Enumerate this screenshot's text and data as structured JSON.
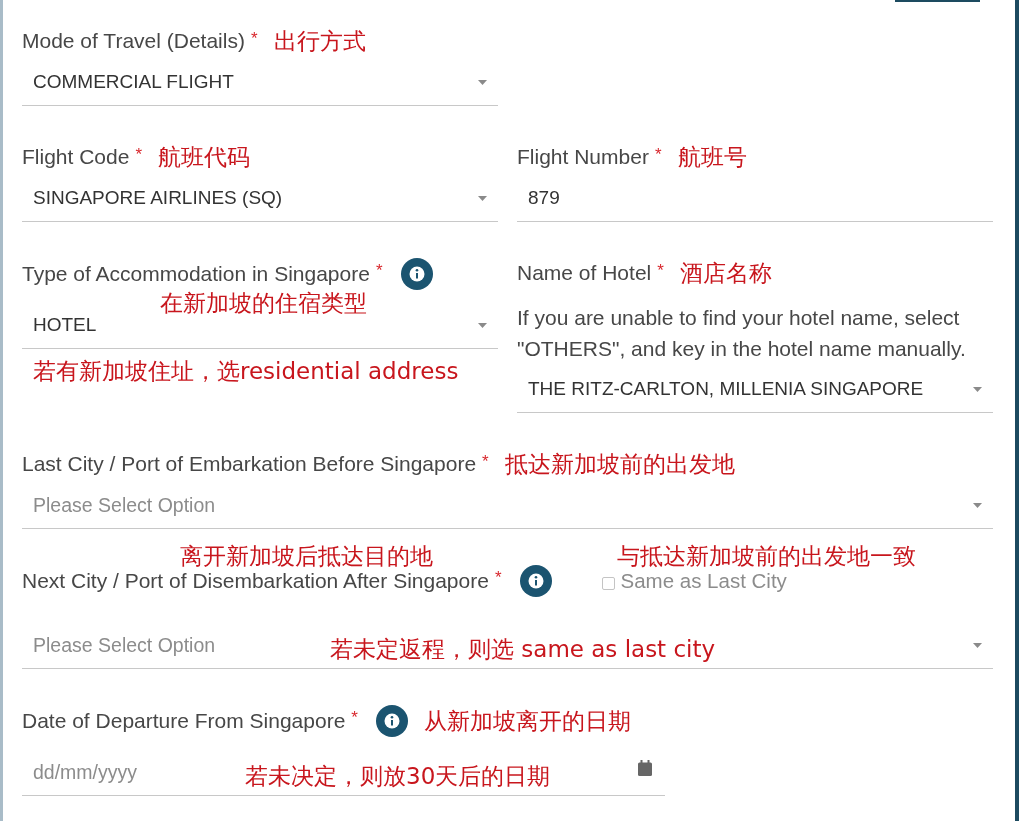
{
  "form": {
    "rows": [
      {
        "kind": "split",
        "fields": [
          {
            "kind": "select",
            "label": "Mode of Travel (Details)",
            "required_mark": "*",
            "info": false,
            "value": "COMMERCIAL FLIGHT",
            "annotations": [
              {
                "text": "出行方式",
                "kind": "beside-label"
              }
            ]
          }
        ]
      },
      {
        "kind": "split",
        "fields": [
          {
            "kind": "select",
            "label": "Flight Code",
            "required_mark": "*",
            "info": false,
            "value": "SINGAPORE AIRLINES (SQ)",
            "annotations": [
              {
                "text": "航班代码",
                "kind": "beside-label"
              }
            ]
          },
          {
            "kind": "text",
            "label": "Flight Number",
            "required_mark": "*",
            "info": false,
            "value": "879",
            "annotations": [
              {
                "text": "航班号",
                "kind": "beside-label"
              }
            ]
          }
        ]
      },
      {
        "kind": "split",
        "fields": [
          {
            "kind": "select",
            "label": "Type of Accommodation in Singapore",
            "required_mark": "*",
            "info": true,
            "value": "HOTEL",
            "annotations": [
              {
                "text": "在新加坡的住宿类型",
                "kind": "under-label"
              },
              {
                "text": "若有新加坡住址，选residential address",
                "kind": "under-field"
              }
            ]
          },
          {
            "kind": "select",
            "label": "Name of Hotel",
            "required_mark": "*",
            "info": false,
            "help": "If you are unable to find your hotel name, select \"OTHERS\", and key in the hotel name manually.",
            "value": "THE RITZ-CARLTON, MILLENIA SINGAPORE",
            "annotations": [
              {
                "text": "酒店名称",
                "kind": "beside-label"
              }
            ]
          }
        ]
      },
      {
        "kind": "wide",
        "fields": [
          {
            "kind": "select",
            "label": "Last City / Port of Embarkation Before Singapore",
            "required_mark": "*",
            "info": false,
            "placeholder": "Please Select Option",
            "annotations": [
              {
                "text": "抵达新加坡前的出发地",
                "kind": "beside-label"
              }
            ]
          }
        ]
      },
      {
        "kind": "wide",
        "fields": [
          {
            "kind": "select",
            "label": "Next City / Port of Disembarkation After Singapore",
            "required_mark": "*",
            "info": true,
            "checkbox": {
              "label": "Same as Last City",
              "checked": false,
              "annotation": "与抵达新加坡前的出发地一致"
            },
            "placeholder": "Please Select Option",
            "annotations": [
              {
                "text": "离开新加坡后抵达目的地",
                "kind": "over-label"
              },
              {
                "text": "若未定返程，则选 same as last city",
                "kind": "in-field"
              }
            ]
          }
        ]
      },
      {
        "kind": "wide",
        "fields": [
          {
            "kind": "date",
            "label": "Date of Departure From Singapore",
            "required_mark": "*",
            "info": true,
            "placeholder": "dd/mm/yyyy",
            "annotations": [
              {
                "text": "从新加坡离开的日期",
                "kind": "beside-label"
              },
              {
                "text": "若未决定，则放30天后的日期",
                "kind": "in-field"
              }
            ]
          }
        ]
      }
    ]
  }
}
